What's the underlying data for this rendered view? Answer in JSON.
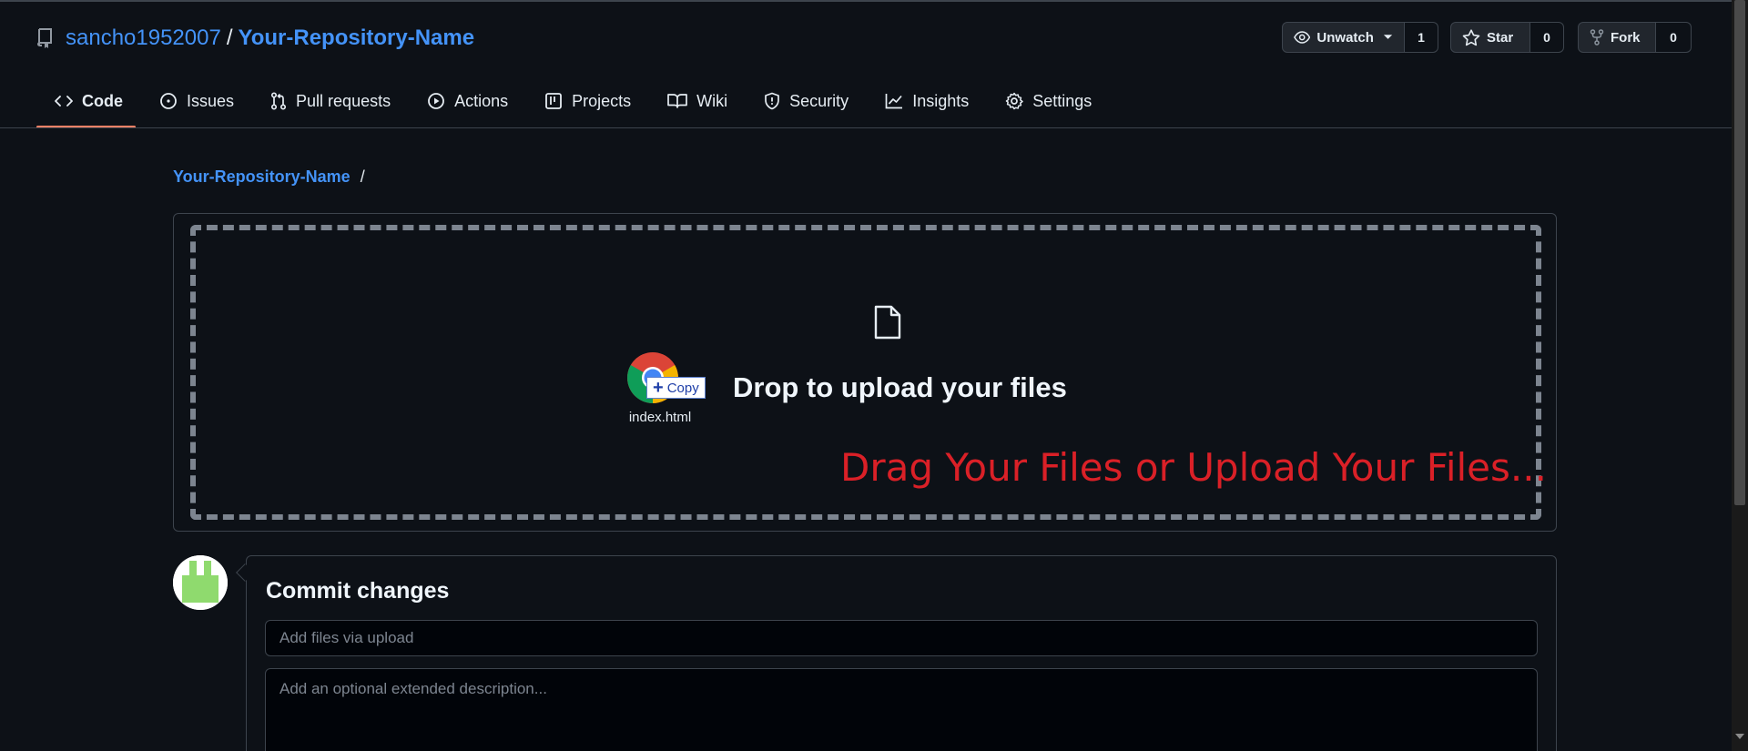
{
  "repo": {
    "owner": "sancho1952007",
    "separator": "/",
    "name": "Your-Repository-Name"
  },
  "actions": {
    "watch": {
      "label": "Unwatch",
      "count": "1"
    },
    "star": {
      "label": "Star",
      "count": "0"
    },
    "fork": {
      "label": "Fork",
      "count": "0"
    }
  },
  "nav": {
    "tabs": [
      {
        "label": "Code",
        "icon": "code-icon",
        "active": true
      },
      {
        "label": "Issues",
        "icon": "issue-opened-icon"
      },
      {
        "label": "Pull requests",
        "icon": "pull-request-icon"
      },
      {
        "label": "Actions",
        "icon": "play-icon"
      },
      {
        "label": "Projects",
        "icon": "table-icon"
      },
      {
        "label": "Wiki",
        "icon": "book-icon"
      },
      {
        "label": "Security",
        "icon": "shield-icon"
      },
      {
        "label": "Insights",
        "icon": "graph-icon"
      },
      {
        "label": "Settings",
        "icon": "gear-icon"
      }
    ]
  },
  "breadcrumb": {
    "repo": "Your-Repository-Name",
    "separator": "/"
  },
  "upload": {
    "drop_text": "Drop to upload your files",
    "overlay_text": "Drag Your Files or Upload Your Files...",
    "overlay_color": "#da2027",
    "drag_file_name": "index.html",
    "drag_tooltip": "Copy"
  },
  "commit": {
    "title": "Commit changes",
    "summary_placeholder": "Add files via upload",
    "description_placeholder": "Add an optional extended description..."
  },
  "colors": {
    "background": "#0d1117",
    "link": "#4493f8",
    "border": "#3d444d",
    "active_tab_underline": "#f78166"
  }
}
